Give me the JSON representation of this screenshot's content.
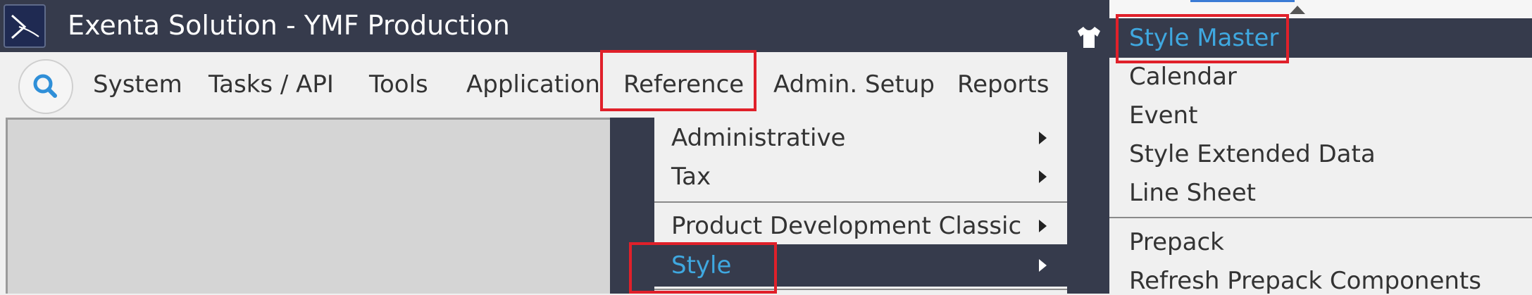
{
  "window": {
    "title": "Exenta Solution - YMF Production"
  },
  "menubar": {
    "items": [
      "System",
      "Tasks / API",
      "Tools",
      "Application",
      "Reference",
      "Admin. Setup",
      "Reports"
    ]
  },
  "reference_menu": {
    "items": [
      "Administrative",
      "Tax",
      "Product Development Classic",
      "Style"
    ]
  },
  "style_submenu": {
    "items": [
      "Style Master",
      "Calendar",
      "Event",
      "Style Extended Data",
      "Line Sheet",
      "Prepack",
      "Refresh Prepack Components"
    ]
  },
  "colors": {
    "dark_chrome": "#363b4c",
    "highlight_text": "#3fa8e0",
    "annotation_red": "#e0202a",
    "search_icon": "#2f8fd8"
  },
  "icons": [
    "app-logo-icon",
    "search-icon",
    "submenu-arrow-icon",
    "shirt-icon",
    "scroll-up-icon"
  ]
}
